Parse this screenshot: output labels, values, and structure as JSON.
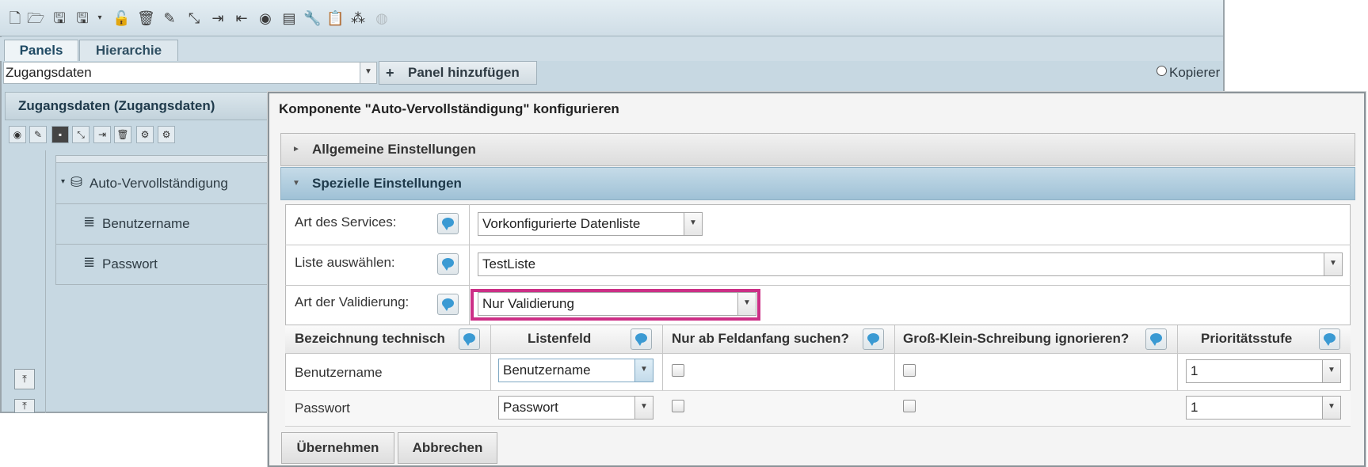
{
  "toolbar": {
    "icons": [
      "new-document-icon",
      "open-folder-icon",
      "save-icon",
      "save-as-icon",
      "dropdown-arrow-icon",
      "unlock-icon",
      "delete-icon",
      "edit-document-icon",
      "collapse-icon",
      "export-icon",
      "import-icon",
      "preview-eye-icon",
      "report-icon",
      "wrench-icon",
      "clipboard-icon",
      "network-icon",
      "globe-icon"
    ]
  },
  "tabs": [
    "Panels",
    "Hierarchie"
  ],
  "panel_select": {
    "value": "Zugangsdaten"
  },
  "add_panel": {
    "plus": "+",
    "label": "Panel hinzufügen"
  },
  "kopieren_label": "Kopierer",
  "left_panel": {
    "title": "Zugangsdaten (Zugangsdaten)",
    "tree": [
      {
        "label": "Auto-Vervollständigung",
        "icon": "database-icon"
      },
      {
        "label": "Benutzername",
        "icon": "list-icon"
      },
      {
        "label": "Passwort",
        "icon": "list-icon"
      }
    ]
  },
  "dialog": {
    "title": "Komponente \"Auto-Vervollständigung\" konfigurieren",
    "sections": {
      "general": "Allgemeine Einstellungen",
      "special": "Spezielle Einstellungen"
    },
    "fields": {
      "service_type": {
        "label": "Art des Services:",
        "value": "Vorkonfigurierte Datenliste"
      },
      "list": {
        "label": "Liste auswählen:",
        "value": "TestListe"
      },
      "validation": {
        "label": "Art der Validierung:",
        "value": "Nur Validierung"
      }
    },
    "grid": {
      "headers": [
        "Bezeichnung technisch",
        "Listenfeld",
        "Nur ab Feldanfang suchen?",
        "Groß-Klein-Schreibung ignorieren?",
        "Prioritätsstufe"
      ],
      "rows": [
        {
          "name": "Benutzername",
          "field": "Benutzername",
          "from_start": false,
          "ignore_case": false,
          "priority": "1"
        },
        {
          "name": "Passwort",
          "field": "Passwort",
          "from_start": false,
          "ignore_case": false,
          "priority": "1"
        }
      ]
    },
    "buttons": {
      "apply": "Übernehmen",
      "cancel": "Abbrechen"
    }
  },
  "colors": {
    "highlight": "#cc2f86",
    "accent_section": "#9fc1d6",
    "info_icon": "#3a9ad3"
  }
}
